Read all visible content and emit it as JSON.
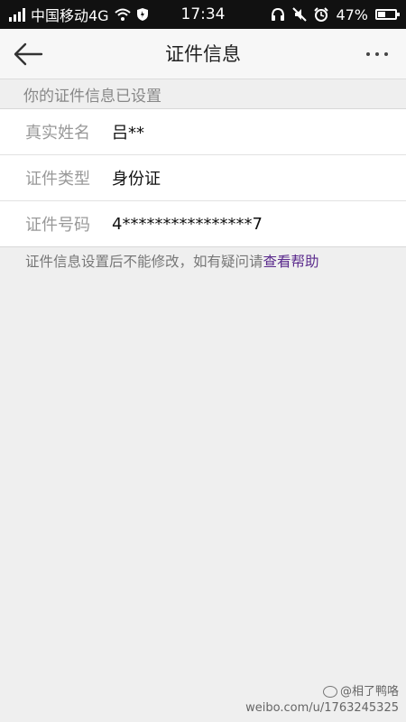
{
  "status_bar": {
    "carrier": "中国移动4G",
    "time": "17:34",
    "battery": "47%",
    "battery_level": 0.47
  },
  "header": {
    "title": "证件信息"
  },
  "section_hint": "你的证件信息已设置",
  "fields": [
    {
      "label": "真实姓名",
      "value": "吕**"
    },
    {
      "label": "证件类型",
      "value": "身份证"
    },
    {
      "label": "证件号码",
      "value": "4****************7"
    }
  ],
  "note": {
    "text": "证件信息设置后不能修改，如有疑问请",
    "link": "查看帮助"
  },
  "watermark": {
    "handle": "@相了鸭咯",
    "url": "weibo.com/u/1763245325"
  },
  "icons": [
    "signal-icon",
    "wifi-icon",
    "shield-icon",
    "headphones-icon",
    "mute-icon",
    "alarm-icon",
    "battery-icon",
    "back-arrow-icon",
    "more-dots-icon"
  ]
}
